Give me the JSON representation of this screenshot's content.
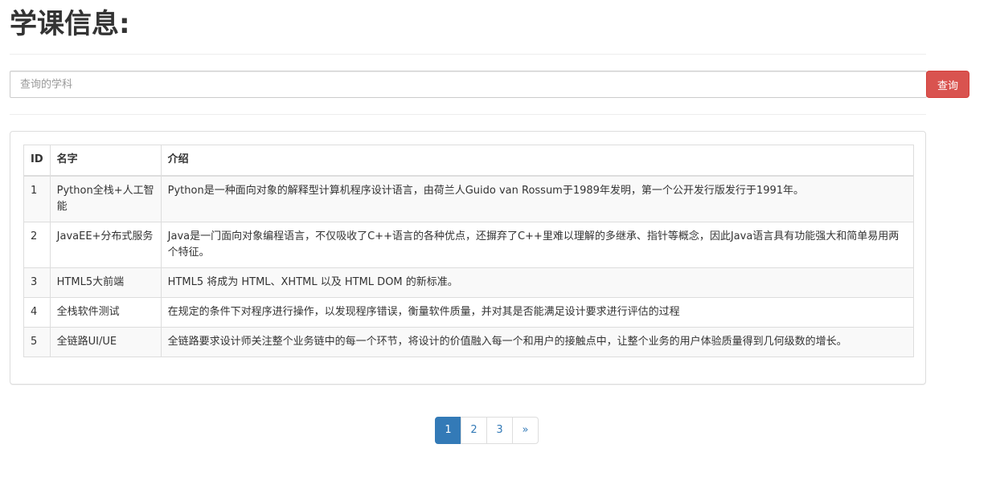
{
  "page": {
    "title": "学课信息:"
  },
  "search": {
    "placeholder": "查询的学科",
    "value": "",
    "button_label": "查询"
  },
  "table": {
    "headers": [
      "ID",
      "名字",
      "介绍"
    ],
    "rows": [
      [
        "1",
        "Python全栈+人工智能",
        "Python是一种面向对象的解释型计算机程序设计语言，由荷兰人Guido van Rossum于1989年发明，第一个公开发行版发行于1991年。"
      ],
      [
        "2",
        "JavaEE+分布式服务",
        "Java是一门面向对象编程语言，不仅吸收了C++语言的各种优点，还摒弃了C++里难以理解的多继承、指针等概念，因此Java语言具有功能强大和简单易用两个特征。"
      ],
      [
        "3",
        "HTML5大前端",
        "HTML5 将成为 HTML、XHTML 以及 HTML DOM 的新标准。"
      ],
      [
        "4",
        "全栈软件测试",
        "在规定的条件下对程序进行操作，以发现程序错误，衡量软件质量，并对其是否能满足设计要求进行评估的过程"
      ],
      [
        "5",
        "全链路UI/UE",
        "全链路要求设计师关注整个业务链中的每一个环节，将设计的价值融入每一个和用户的接触点中，让整个业务的用户体验质量得到几何级数的增长。"
      ]
    ]
  },
  "pagination": {
    "pages": [
      "1",
      "2",
      "3"
    ],
    "current": "1",
    "next_label": "»"
  },
  "colors": {
    "danger": "#d9534f",
    "primary": "#337ab7"
  }
}
